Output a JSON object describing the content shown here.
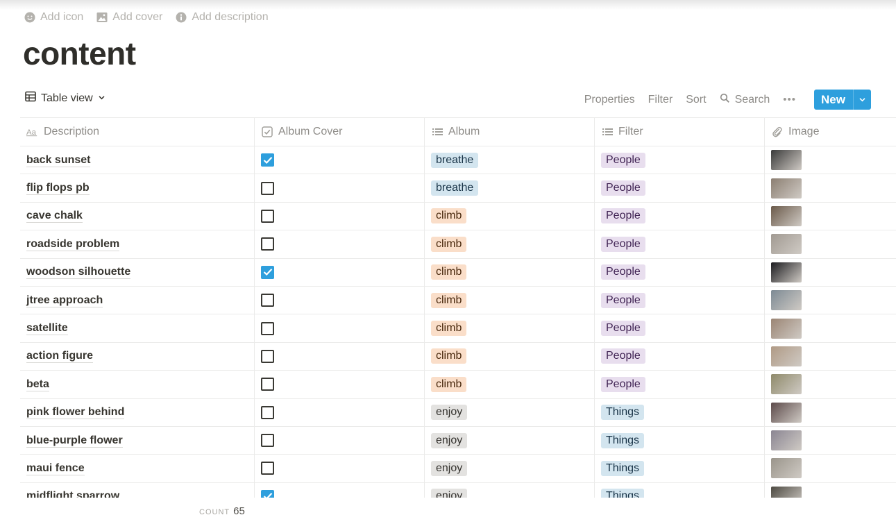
{
  "page_actions": [
    {
      "icon": "smiley-icon",
      "label": "Add icon"
    },
    {
      "icon": "image-icon",
      "label": "Add cover"
    },
    {
      "icon": "info-icon",
      "label": "Add description"
    }
  ],
  "title": "content",
  "view": {
    "label": "Table view",
    "icon": "table-icon"
  },
  "tools": {
    "properties": "Properties",
    "filter": "Filter",
    "sort": "Sort",
    "search": "Search",
    "more": "•••",
    "new": "New"
  },
  "columns": [
    {
      "label": "Description",
      "icon": "text-property-icon"
    },
    {
      "label": "Album Cover",
      "icon": "checkbox-property-icon"
    },
    {
      "label": "Album",
      "icon": "select-property-icon"
    },
    {
      "label": "Filter",
      "icon": "select-property-icon"
    },
    {
      "label": "Image",
      "icon": "file-property-icon"
    }
  ],
  "tag_colors": {
    "breathe": {
      "bg": "#d3e5ef",
      "fg": "#183347"
    },
    "climb": {
      "bg": "#fadec9",
      "fg": "#49290e"
    },
    "enjoy": {
      "bg": "#e3e2e0",
      "fg": "#32302c"
    },
    "People": {
      "bg": "#e8deee",
      "fg": "#412454"
    },
    "Things": {
      "bg": "#d3e5ef",
      "fg": "#183347"
    }
  },
  "rows": [
    {
      "desc": "back sunset",
      "cover": true,
      "album": "breathe",
      "filter": "People",
      "thumb": "#3a3a3a"
    },
    {
      "desc": "flip flops pb",
      "cover": false,
      "album": "breathe",
      "filter": "People",
      "thumb": "#8c7f72"
    },
    {
      "desc": "cave chalk",
      "cover": false,
      "album": "climb",
      "filter": "People",
      "thumb": "#6b5a4a"
    },
    {
      "desc": "roadside problem",
      "cover": false,
      "album": "climb",
      "filter": "People",
      "thumb": "#a19a92"
    },
    {
      "desc": "woodson silhouette",
      "cover": true,
      "album": "climb",
      "filter": "People",
      "thumb": "#1c1c20"
    },
    {
      "desc": "jtree approach",
      "cover": false,
      "album": "climb",
      "filter": "People",
      "thumb": "#7d8a94"
    },
    {
      "desc": "satellite",
      "cover": false,
      "album": "climb",
      "filter": "People",
      "thumb": "#9b8574"
    },
    {
      "desc": "action figure",
      "cover": false,
      "album": "climb",
      "filter": "People",
      "thumb": "#b09a85"
    },
    {
      "desc": "beta",
      "cover": false,
      "album": "climb",
      "filter": "People",
      "thumb": "#8f8a6a"
    },
    {
      "desc": "pink flower behind",
      "cover": false,
      "album": "enjoy",
      "filter": "Things",
      "thumb": "#5c4a4a"
    },
    {
      "desc": "blue-purple flower",
      "cover": false,
      "album": "enjoy",
      "filter": "Things",
      "thumb": "#8a8592"
    },
    {
      "desc": "maui fence",
      "cover": false,
      "album": "enjoy",
      "filter": "Things",
      "thumb": "#9a958b"
    },
    {
      "desc": "midflight sparrow",
      "cover": true,
      "album": "enjoy",
      "filter": "Things",
      "thumb": "#4d4a42"
    }
  ],
  "footer": {
    "count_label": "COUNT",
    "count": "65"
  }
}
